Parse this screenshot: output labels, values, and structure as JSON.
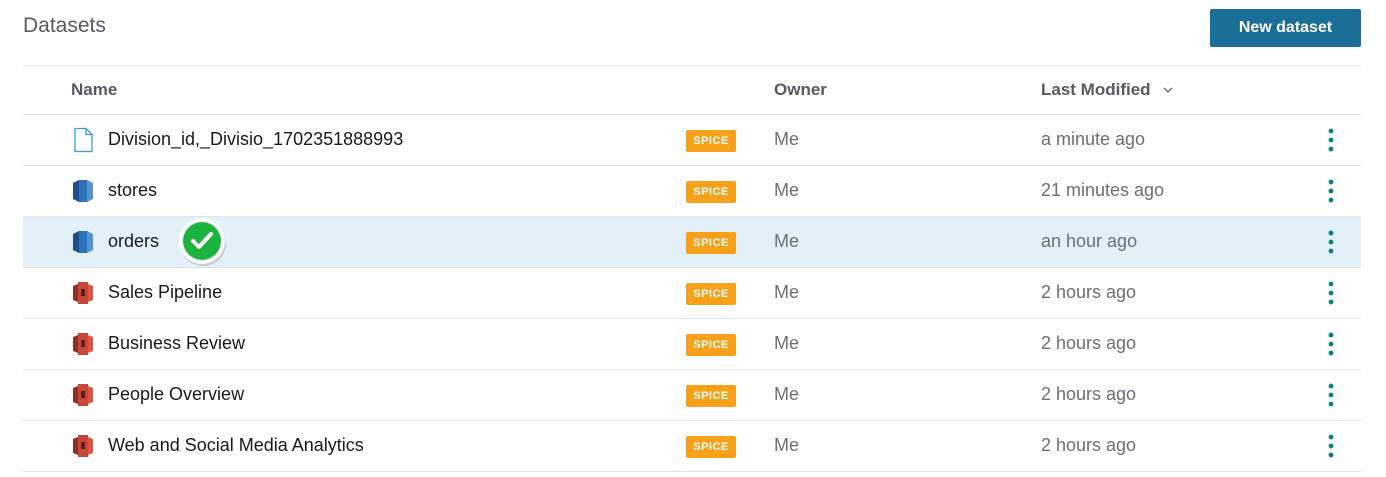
{
  "header": {
    "title": "Datasets",
    "new_button_label": "New dataset"
  },
  "table": {
    "columns": {
      "name": "Name",
      "owner": "Owner",
      "last_modified": "Last Modified"
    },
    "rows": [
      {
        "name": "Division_id,_Divisio_1702351888993",
        "icon": "file-icon",
        "badge": "SPICE",
        "owner": "Me",
        "modified": "a minute ago"
      },
      {
        "name": "stores",
        "icon": "database-icon",
        "badge": "SPICE",
        "owner": "Me",
        "modified": "21 minutes ago"
      },
      {
        "name": "orders",
        "icon": "database-icon",
        "badge": "SPICE",
        "owner": "Me",
        "modified": "an hour ago",
        "selected": true
      },
      {
        "name": "Sales Pipeline",
        "icon": "s3-bucket-icon",
        "badge": "SPICE",
        "owner": "Me",
        "modified": "2 hours ago"
      },
      {
        "name": "Business Review",
        "icon": "s3-bucket-icon",
        "badge": "SPICE",
        "owner": "Me",
        "modified": "2 hours ago"
      },
      {
        "name": "People Overview",
        "icon": "s3-bucket-icon",
        "badge": "SPICE",
        "owner": "Me",
        "modified": "2 hours ago"
      },
      {
        "name": "Web and Social Media Analytics",
        "icon": "s3-bucket-icon",
        "badge": "SPICE",
        "owner": "Me",
        "modified": "2 hours ago"
      }
    ]
  },
  "colors": {
    "primary_button": "#1a6f99",
    "spice_badge": "#f7a11a",
    "selected_row": "#e4f0f7",
    "kebab": "#0b7f7f",
    "check_badge": "#1db33f"
  }
}
